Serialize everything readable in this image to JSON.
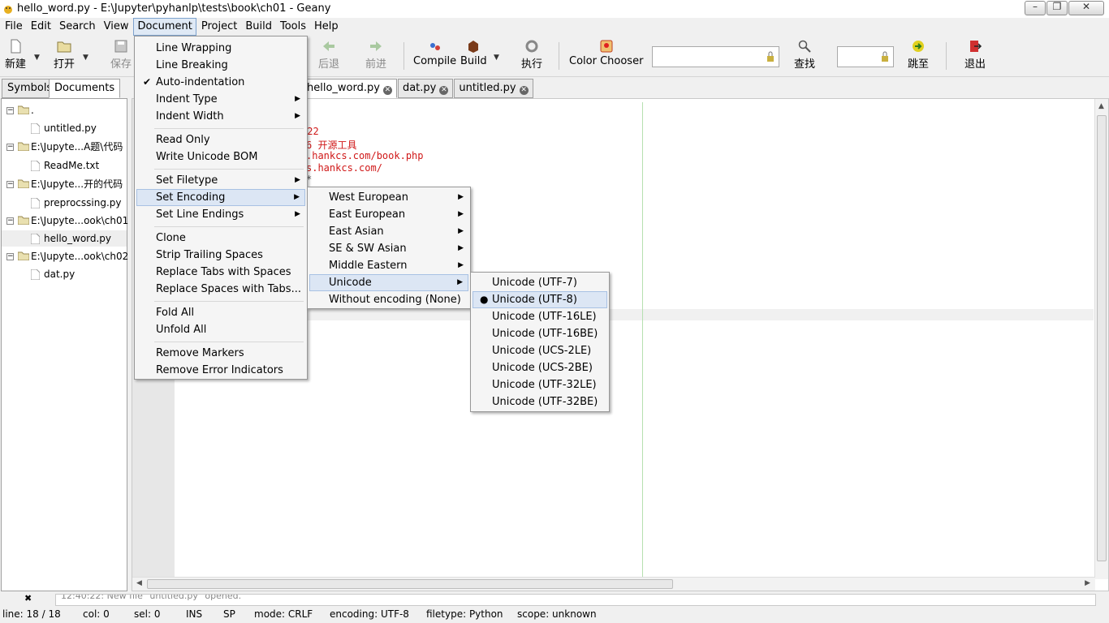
{
  "window": {
    "title": "hello_word.py - E:\\Jupyter\\pyhanlp\\tests\\book\\ch01 - Geany"
  },
  "menubar": [
    "File",
    "Edit",
    "Search",
    "View",
    "Document",
    "Project",
    "Build",
    "Tools",
    "Help"
  ],
  "toolbar": {
    "new": "新建",
    "open": "打开",
    "save": "保存",
    "back": "后退",
    "forward": "前进",
    "compile": "Compile",
    "build": "Build",
    "run": "执行",
    "color_chooser": "Color Chooser",
    "find": "查找",
    "goto": "跳至",
    "quit": "退出",
    "search_value": "",
    "goto_value": ""
  },
  "sidebar": {
    "tabs": [
      "Symbols",
      "Documents"
    ],
    "active_tab": "Documents",
    "tree": [
      {
        "label": ".",
        "type": "folder"
      },
      {
        "label": "untitled.py",
        "type": "file"
      },
      {
        "label": "E:\\Jupyte...A题\\代码",
        "type": "folder"
      },
      {
        "label": "ReadMe.txt",
        "type": "file"
      },
      {
        "label": "E:\\Jupyte...开的代码",
        "type": "folder"
      },
      {
        "label": "preprocssing.py",
        "type": "file"
      },
      {
        "label": "E:\\Jupyte...ook\\ch01",
        "type": "folder"
      },
      {
        "label": "hello_word.py",
        "type": "file",
        "selected": true
      },
      {
        "label": "E:\\Jupyte...ook\\ch02",
        "type": "folder"
      },
      {
        "label": "dat.py",
        "type": "file"
      }
    ]
  },
  "editor": {
    "tabs": [
      "hello_word.py",
      "dat.py",
      "untitled.py"
    ],
    "active_tab": "hello_word.py",
    "visible_code": [
      "-",
      ":22",
      "6 开源工具",
      ".hankcs.com/book.php",
      "s.hankcs.com/",
      "*"
    ]
  },
  "message": {
    "text": "12:40:22: New file \"untitled.py\" opened."
  },
  "status": {
    "line": "line: 18 / 18",
    "col": "col: 0",
    "sel": "sel: 0",
    "ins": "INS",
    "sp": "SP",
    "mode": "mode: CRLF",
    "encoding": "encoding: UTF-8",
    "filetype": "filetype: Python",
    "scope": "scope: unknown"
  },
  "document_menu": [
    "Line Wrapping",
    "Line Breaking",
    "Auto-indentation",
    "Indent Type",
    "Indent Width",
    "Read Only",
    "Write Unicode BOM",
    "Set Filetype",
    "Set Encoding",
    "Set Line Endings",
    "Clone",
    "Strip Trailing Spaces",
    "Replace Tabs with Spaces",
    "Replace Spaces with Tabs...",
    "Fold All",
    "Unfold All",
    "Remove Markers",
    "Remove Error Indicators"
  ],
  "encoding_menu": [
    "West European",
    "East European",
    "East Asian",
    "SE & SW Asian",
    "Middle Eastern",
    "Unicode",
    "Without encoding (None)"
  ],
  "unicode_menu": [
    "Unicode (UTF-7)",
    "Unicode (UTF-8)",
    "Unicode (UTF-16LE)",
    "Unicode (UTF-16BE)",
    "Unicode (UCS-2LE)",
    "Unicode (UCS-2BE)",
    "Unicode (UTF-32LE)",
    "Unicode (UTF-32BE)"
  ],
  "colors": {
    "code": "#d01818",
    "highlight": "#dce6f4"
  }
}
